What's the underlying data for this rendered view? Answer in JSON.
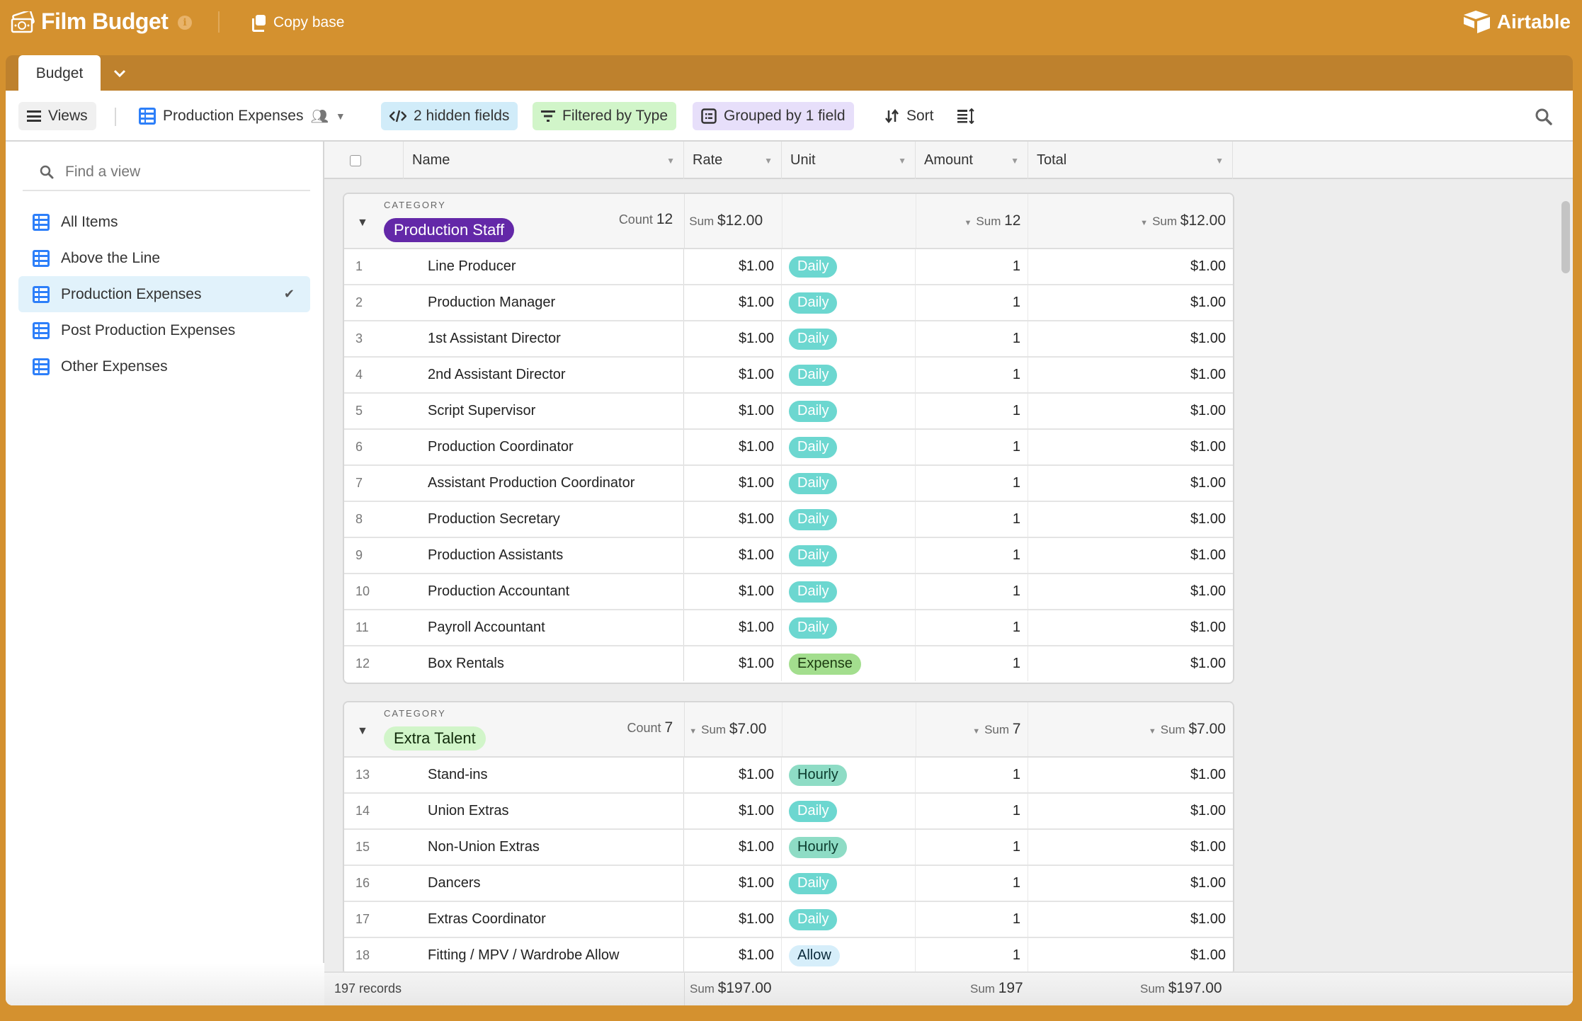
{
  "app": {
    "base_title": "Film Budget",
    "copy_base_label": "Copy base",
    "brand": "Airtable",
    "accent_color": "#D4912F"
  },
  "tabs": [
    {
      "label": "Budget",
      "active": true
    }
  ],
  "toolbar": {
    "views_label": "Views",
    "current_view": "Production Expenses",
    "hidden_fields": "2 hidden fields",
    "filter": "Filtered by Type",
    "group": "Grouped by 1 field",
    "sort": "Sort"
  },
  "sidebar": {
    "search_placeholder": "Find a view",
    "views": [
      {
        "label": "All Items",
        "active": false
      },
      {
        "label": "Above the Line",
        "active": false
      },
      {
        "label": "Production Expenses",
        "active": true
      },
      {
        "label": "Post Production Expenses",
        "active": false
      },
      {
        "label": "Other Expenses",
        "active": false
      }
    ]
  },
  "columns": [
    "Name",
    "Rate",
    "Unit",
    "Amount",
    "Total"
  ],
  "unit_colors": {
    "Daily": {
      "bg": "#6CD7D0",
      "fg": "#ffffff"
    },
    "Hourly": {
      "bg": "#8EDCC5",
      "fg": "#0b3b2e"
    },
    "Expense": {
      "bg": "#A3DE8E",
      "fg": "#1c3a10"
    },
    "Allow": {
      "bg": "#D6EEFA",
      "fg": "#0b2a3b"
    }
  },
  "groups": [
    {
      "field_label": "CATEGORY",
      "name": "Production Staff",
      "chip_bg": "#6328A8",
      "chip_fg": "#ffffff",
      "count_label": "Count",
      "count": "12",
      "sum_label": "Sum",
      "rate_sum": "$12.00",
      "amount_sum": "12",
      "total_sum": "$12.00",
      "rows": [
        {
          "num": "1",
          "name": "Line Producer",
          "rate": "$1.00",
          "unit": "Daily",
          "amount": "1",
          "total": "$1.00"
        },
        {
          "num": "2",
          "name": "Production Manager",
          "rate": "$1.00",
          "unit": "Daily",
          "amount": "1",
          "total": "$1.00"
        },
        {
          "num": "3",
          "name": "1st Assistant Director",
          "rate": "$1.00",
          "unit": "Daily",
          "amount": "1",
          "total": "$1.00"
        },
        {
          "num": "4",
          "name": "2nd Assistant Director",
          "rate": "$1.00",
          "unit": "Daily",
          "amount": "1",
          "total": "$1.00"
        },
        {
          "num": "5",
          "name": "Script Supervisor",
          "rate": "$1.00",
          "unit": "Daily",
          "amount": "1",
          "total": "$1.00"
        },
        {
          "num": "6",
          "name": "Production Coordinator",
          "rate": "$1.00",
          "unit": "Daily",
          "amount": "1",
          "total": "$1.00"
        },
        {
          "num": "7",
          "name": "Assistant Production Coordinator",
          "rate": "$1.00",
          "unit": "Daily",
          "amount": "1",
          "total": "$1.00"
        },
        {
          "num": "8",
          "name": "Production Secretary",
          "rate": "$1.00",
          "unit": "Daily",
          "amount": "1",
          "total": "$1.00"
        },
        {
          "num": "9",
          "name": "Production Assistants",
          "rate": "$1.00",
          "unit": "Daily",
          "amount": "1",
          "total": "$1.00"
        },
        {
          "num": "10",
          "name": "Production Accountant",
          "rate": "$1.00",
          "unit": "Daily",
          "amount": "1",
          "total": "$1.00"
        },
        {
          "num": "11",
          "name": "Payroll Accountant",
          "rate": "$1.00",
          "unit": "Daily",
          "amount": "1",
          "total": "$1.00"
        },
        {
          "num": "12",
          "name": "Box Rentals",
          "rate": "$1.00",
          "unit": "Expense",
          "amount": "1",
          "total": "$1.00"
        }
      ]
    },
    {
      "field_label": "CATEGORY",
      "name": "Extra Talent",
      "chip_bg": "#D1F5C9",
      "chip_fg": "#102a0a",
      "count_label": "Count",
      "count": "7",
      "sum_label": "Sum",
      "rate_sum": "$7.00",
      "amount_sum": "7",
      "total_sum": "$7.00",
      "rows": [
        {
          "num": "13",
          "name": "Stand-ins",
          "rate": "$1.00",
          "unit": "Hourly",
          "amount": "1",
          "total": "$1.00"
        },
        {
          "num": "14",
          "name": "Union Extras",
          "rate": "$1.00",
          "unit": "Daily",
          "amount": "1",
          "total": "$1.00"
        },
        {
          "num": "15",
          "name": "Non-Union Extras",
          "rate": "$1.00",
          "unit": "Hourly",
          "amount": "1",
          "total": "$1.00"
        },
        {
          "num": "16",
          "name": "Dancers",
          "rate": "$1.00",
          "unit": "Daily",
          "amount": "1",
          "total": "$1.00"
        },
        {
          "num": "17",
          "name": "Extras Coordinator",
          "rate": "$1.00",
          "unit": "Daily",
          "amount": "1",
          "total": "$1.00"
        },
        {
          "num": "18",
          "name": "Fitting / MPV / Wardrobe Allow",
          "rate": "$1.00",
          "unit": "Allow",
          "amount": "1",
          "total": "$1.00"
        }
      ]
    }
  ],
  "footer": {
    "records": "197 records",
    "sum_label": "Sum",
    "rate_sum": "$197.00",
    "amount_sum": "197",
    "total_sum": "$197.00"
  }
}
